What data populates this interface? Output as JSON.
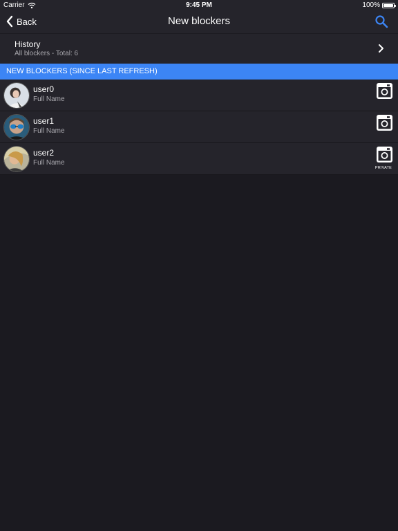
{
  "status_bar": {
    "carrier": "Carrier",
    "time": "9:45 PM",
    "battery": "100%"
  },
  "nav": {
    "back_label": "Back",
    "title": "New blockers"
  },
  "history": {
    "title": "History",
    "subtitle": "All blockers - Total: 6"
  },
  "section_header": "NEW BLOCKERS (SINCE LAST REFRESH)",
  "users": [
    {
      "username": "user0",
      "full_name": "Full Name",
      "private": ""
    },
    {
      "username": "user1",
      "full_name": "Full Name",
      "private": ""
    },
    {
      "username": "user2",
      "full_name": "Full Name",
      "private": "PRIVATE"
    }
  ],
  "colors": {
    "accent": "#3c85f5",
    "background": "#1b1a20",
    "row": "#25242b"
  }
}
